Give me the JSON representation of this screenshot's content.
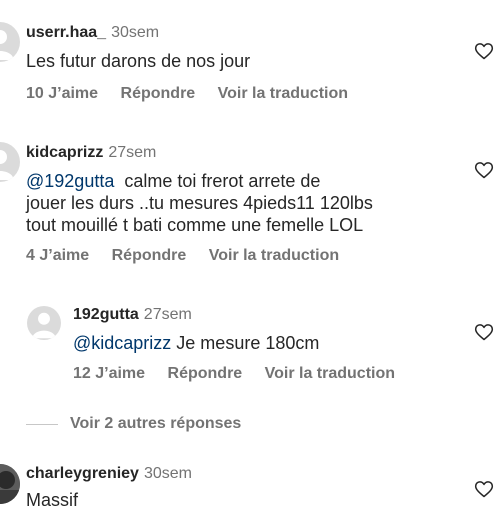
{
  "comments": [
    {
      "username": "userr.haa_",
      "time": "30sem",
      "text": "Les futur darons de nos jour",
      "likes": "10 J’aime",
      "reply": "Répondre",
      "translate": "Voir la traduction"
    },
    {
      "username": "kidcaprizz",
      "time": "27sem",
      "mention": "@192gutta",
      "line1_rest": "  calme toi frerot arrete de",
      "line2": "jouer les durs ..tu mesures 4pieds11 120lbs",
      "line3": "tout mouillé t bati comme une femelle LOL",
      "likes": "4 J’aime",
      "reply": "Répondre",
      "translate": "Voir la traduction"
    },
    {
      "username": "192gutta",
      "time": "27sem",
      "mention": "@kidcaprizz",
      "text_rest": " Je mesure 180cm",
      "likes": "12 J’aime",
      "reply": "Répondre",
      "translate": "Voir la traduction"
    },
    {
      "username": "charleygreniey",
      "time": "30sem",
      "text": "Massif"
    }
  ],
  "view_more_replies": "Voir 2 autres réponses",
  "icons": {
    "like": "heart-icon",
    "avatar_placeholder": "user-silhouette-icon"
  },
  "colors": {
    "mention": "#00376b",
    "muted": "#737373",
    "text": "#262626"
  }
}
